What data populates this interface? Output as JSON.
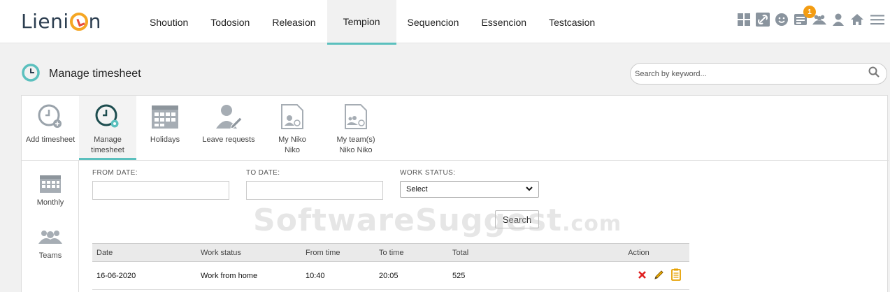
{
  "app": {
    "logo_text_pre": "Lieni",
    "logo_text_post": "n"
  },
  "nav": {
    "items": [
      {
        "label": "Shoution"
      },
      {
        "label": "Todosion"
      },
      {
        "label": "Releasion"
      },
      {
        "label": "Tempion"
      },
      {
        "label": "Sequencion"
      },
      {
        "label": "Essencion"
      },
      {
        "label": "Testcasion"
      }
    ],
    "active": "Tempion",
    "notification_count": "1"
  },
  "page": {
    "title": "Manage timesheet",
    "search_placeholder": "Search by keyword..."
  },
  "tabs": [
    {
      "label_line1": "Add timesheet",
      "label_line2": ""
    },
    {
      "label_line1": "Manage",
      "label_line2": "timesheet"
    },
    {
      "label_line1": "Holidays",
      "label_line2": ""
    },
    {
      "label_line1": "Leave requests",
      "label_line2": ""
    },
    {
      "label_line1": "My Niko",
      "label_line2": "Niko"
    },
    {
      "label_line1": "My team(s)",
      "label_line2": "Niko Niko"
    }
  ],
  "sidebar": [
    {
      "label": "Monthly"
    },
    {
      "label": "Teams"
    }
  ],
  "filters": {
    "from_date_label": "FROM DATE:",
    "from_date_value": "",
    "to_date_label": "TO DATE:",
    "to_date_value": "",
    "work_status_label": "WORK STATUS:",
    "work_status_value": "Select",
    "search_label": "Search"
  },
  "table": {
    "columns": [
      "Date",
      "Work status",
      "From time",
      "To time",
      "Total",
      "Action"
    ],
    "rows": [
      {
        "date": "16-06-2020",
        "work_status": "Work from home",
        "from_time": "10:40",
        "to_time": "20:05",
        "total": "525"
      }
    ]
  },
  "watermark": {
    "main": "SoftwareSuggest",
    "suffix": ".com"
  },
  "colors": {
    "accent": "#5bc0be",
    "delete": "#e02020",
    "edit": "#e6a000",
    "badge": "#f39c12"
  }
}
